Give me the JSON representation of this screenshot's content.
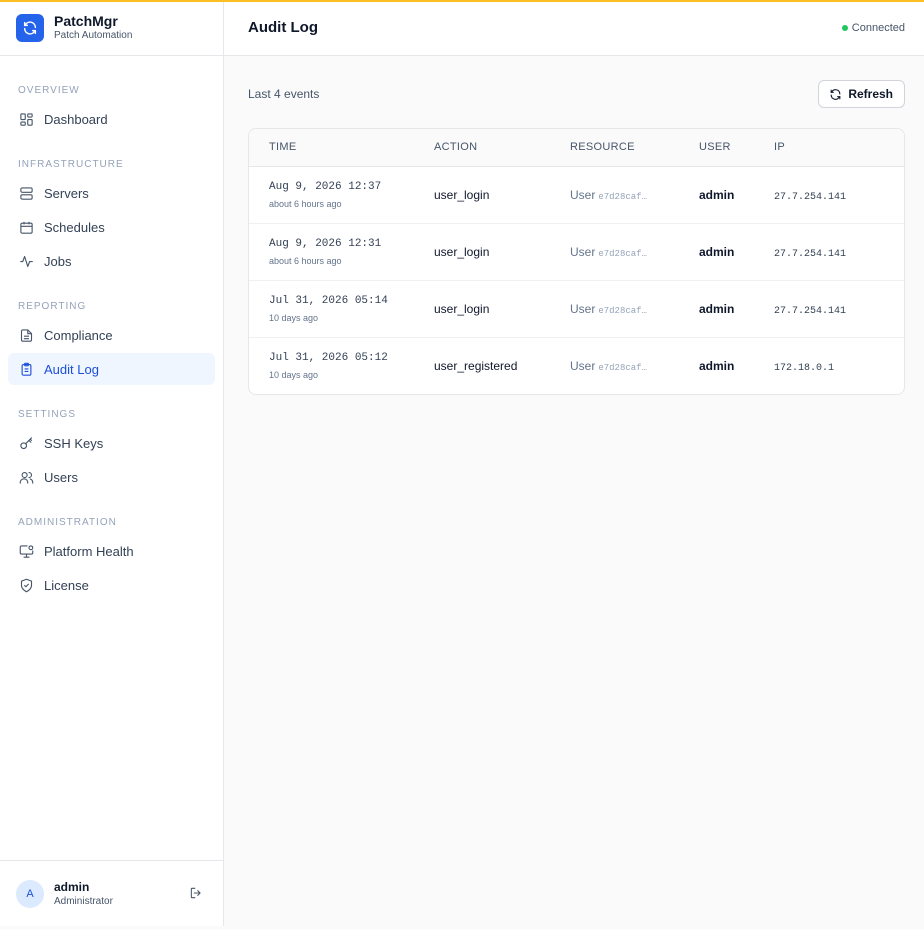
{
  "brand": {
    "name": "PatchMgr",
    "subtitle": "Patch Automation"
  },
  "sidebar": {
    "sections": [
      {
        "title": "OVERVIEW",
        "items": [
          {
            "label": "Dashboard",
            "icon": "dashboard-icon"
          }
        ]
      },
      {
        "title": "INFRASTRUCTURE",
        "items": [
          {
            "label": "Servers",
            "icon": "server-icon"
          },
          {
            "label": "Schedules",
            "icon": "calendar-icon"
          },
          {
            "label": "Jobs",
            "icon": "activity-icon"
          }
        ]
      },
      {
        "title": "REPORTING",
        "items": [
          {
            "label": "Compliance",
            "icon": "document-icon"
          },
          {
            "label": "Audit Log",
            "icon": "clipboard-icon",
            "active": true
          }
        ]
      },
      {
        "title": "SETTINGS",
        "items": [
          {
            "label": "SSH Keys",
            "icon": "key-icon"
          },
          {
            "label": "Users",
            "icon": "users-icon"
          }
        ]
      },
      {
        "title": "ADMINISTRATION",
        "items": [
          {
            "label": "Platform Health",
            "icon": "monitor-icon"
          },
          {
            "label": "License",
            "icon": "shield-check-icon"
          }
        ]
      }
    ]
  },
  "user": {
    "initial": "A",
    "name": "admin",
    "role": "Administrator"
  },
  "header": {
    "title": "Audit Log",
    "status": "Connected"
  },
  "toolbar": {
    "count_label": "Last 4 events",
    "refresh_label": "Refresh"
  },
  "table": {
    "columns": [
      "TIME",
      "ACTION",
      "RESOURCE",
      "USER",
      "IP"
    ],
    "rows": [
      {
        "time": "Aug 9, 2026 12:37",
        "relative": "about 6 hours ago",
        "action": "user_login",
        "resource_type": "User",
        "resource_id": "e7d28caf…",
        "user": "admin",
        "ip": "27.7.254.141"
      },
      {
        "time": "Aug 9, 2026 12:31",
        "relative": "about 6 hours ago",
        "action": "user_login",
        "resource_type": "User",
        "resource_id": "e7d28caf…",
        "user": "admin",
        "ip": "27.7.254.141"
      },
      {
        "time": "Jul 31, 2026 05:14",
        "relative": "10 days ago",
        "action": "user_login",
        "resource_type": "User",
        "resource_id": "e7d28caf…",
        "user": "admin",
        "ip": "27.7.254.141"
      },
      {
        "time": "Jul 31, 2026 05:12",
        "relative": "10 days ago",
        "action": "user_registered",
        "resource_type": "User",
        "resource_id": "e7d28caf…",
        "user": "admin",
        "ip": "172.18.0.1"
      }
    ]
  },
  "colors": {
    "accent": "#2563eb",
    "top_accent": "#fbbf24",
    "status_green": "#22c55e",
    "active_bg": "#eff6ff"
  }
}
